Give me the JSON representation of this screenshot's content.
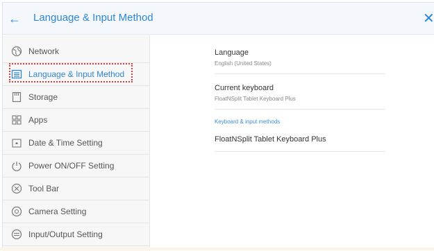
{
  "header": {
    "title": "Language & Input Method",
    "back_icon": "arrow-left-icon",
    "close_icon": "close-icon"
  },
  "sidebar": {
    "items": [
      {
        "label": "Network",
        "icon": "globe-icon"
      },
      {
        "label": "Language & Input Method",
        "icon": "keyboard-icon"
      },
      {
        "label": "Storage",
        "icon": "storage-icon"
      },
      {
        "label": "Apps",
        "icon": "apps-grid-icon"
      },
      {
        "label": "Date & Time Setting",
        "icon": "calendar-icon"
      },
      {
        "label": "Power ON/OFF Setting",
        "icon": "power-icon"
      },
      {
        "label": "Tool Bar",
        "icon": "toolbar-icon"
      },
      {
        "label": "Camera Setting",
        "icon": "camera-icon"
      },
      {
        "label": "Input/Output Setting",
        "icon": "io-icon"
      }
    ],
    "selected": "Language & Input Method"
  },
  "main": {
    "language": {
      "title": "Language",
      "value": "English (United States)"
    },
    "current_keyboard": {
      "title": "Current keyboard",
      "value": "FloatNSplit Tablet Keyboard Plus"
    },
    "section_title": "Keyboard & input methods",
    "keyboard_entry": {
      "title": "FloatNSplit Tablet Keyboard Plus"
    }
  },
  "colors": {
    "accent": "#2f86d6",
    "highlight_box": "#d9393b",
    "sidebar_bg": "#f7f7f7",
    "header_bg": "#f4f7fb"
  }
}
